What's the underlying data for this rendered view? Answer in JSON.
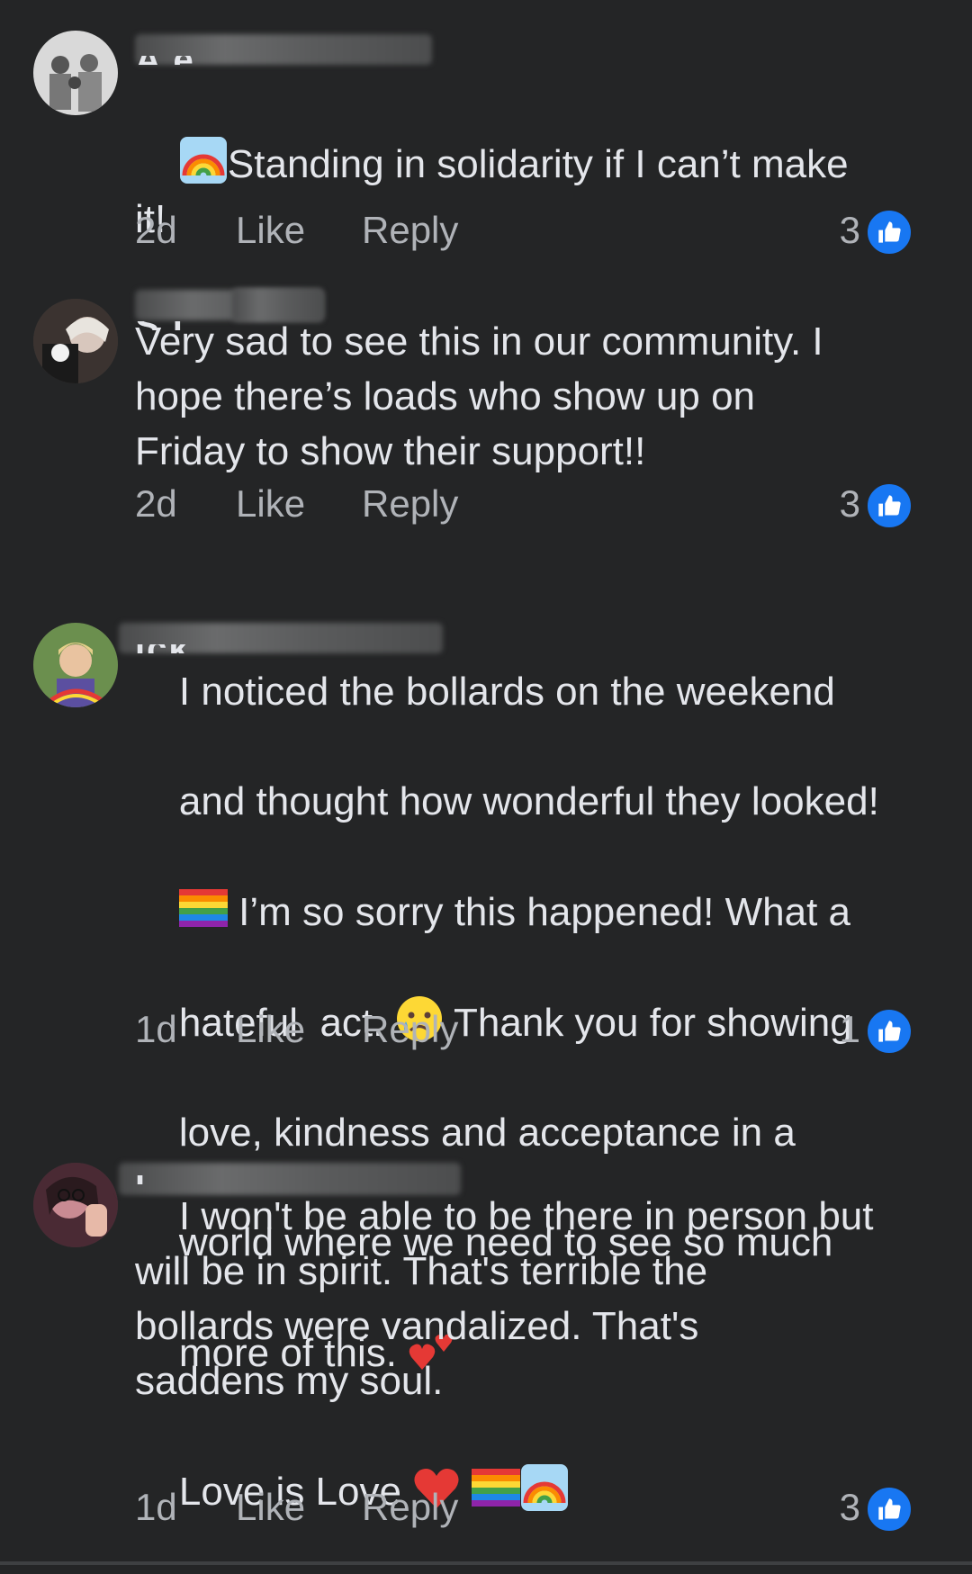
{
  "comments": [
    {
      "name_visible": "A                    e",
      "text_line1": "Standing in solidarity if I can’t make",
      "text_line2": "it!",
      "time": "2d",
      "like": "Like",
      "reply": "Reply",
      "reactions": "3"
    },
    {
      "name_visible": "S                 ı",
      "text": "Very sad to see this in our community. I\nhope there’s loads who show up on\nFriday to show their support!!",
      "time": "2d",
      "like": "Like",
      "reply": "Reply",
      "reactions": "3"
    },
    {
      "name_visible": "             ick",
      "text_line1": "I noticed the bollards on the weekend",
      "text_line2": "and thought how wonderful they looked!",
      "text_line3": " I’m so sorry this happened! What a",
      "text_line4a": "hateful  act. ",
      "text_line4b": " Thank you for showing",
      "text_line5": "love, kindness and acceptance in a",
      "text_line6": "world where we need to see so much",
      "text_line7": "more of this. ",
      "time": "1d",
      "like": "Like",
      "reply": "Reply",
      "reactions": "1"
    },
    {
      "name_visible": "                        l",
      "text": "I won't be able to be there in person but\nwill be in spirit. That's terrible the\nbollards were vandalized. That's\nsaddens my soul.",
      "text_last": "Love is Love ",
      "time": "1d",
      "like": "Like",
      "reply": "Reply",
      "reactions": "3"
    }
  ],
  "icons": {
    "like_reaction": "thumbs-up-icon",
    "emoji_rainbow": "rainbow-emoji",
    "emoji_pride_flag": "pride-flag-emoji",
    "emoji_sad": "sad-tear-emoji",
    "emoji_two_hearts": "two-hearts-emoji",
    "emoji_red_heart": "red-heart-emoji"
  },
  "colors": {
    "background": "#242526",
    "text": "#e4e6eb",
    "secondary_text": "#b0b3b8",
    "like_blue": "#1877f2"
  }
}
